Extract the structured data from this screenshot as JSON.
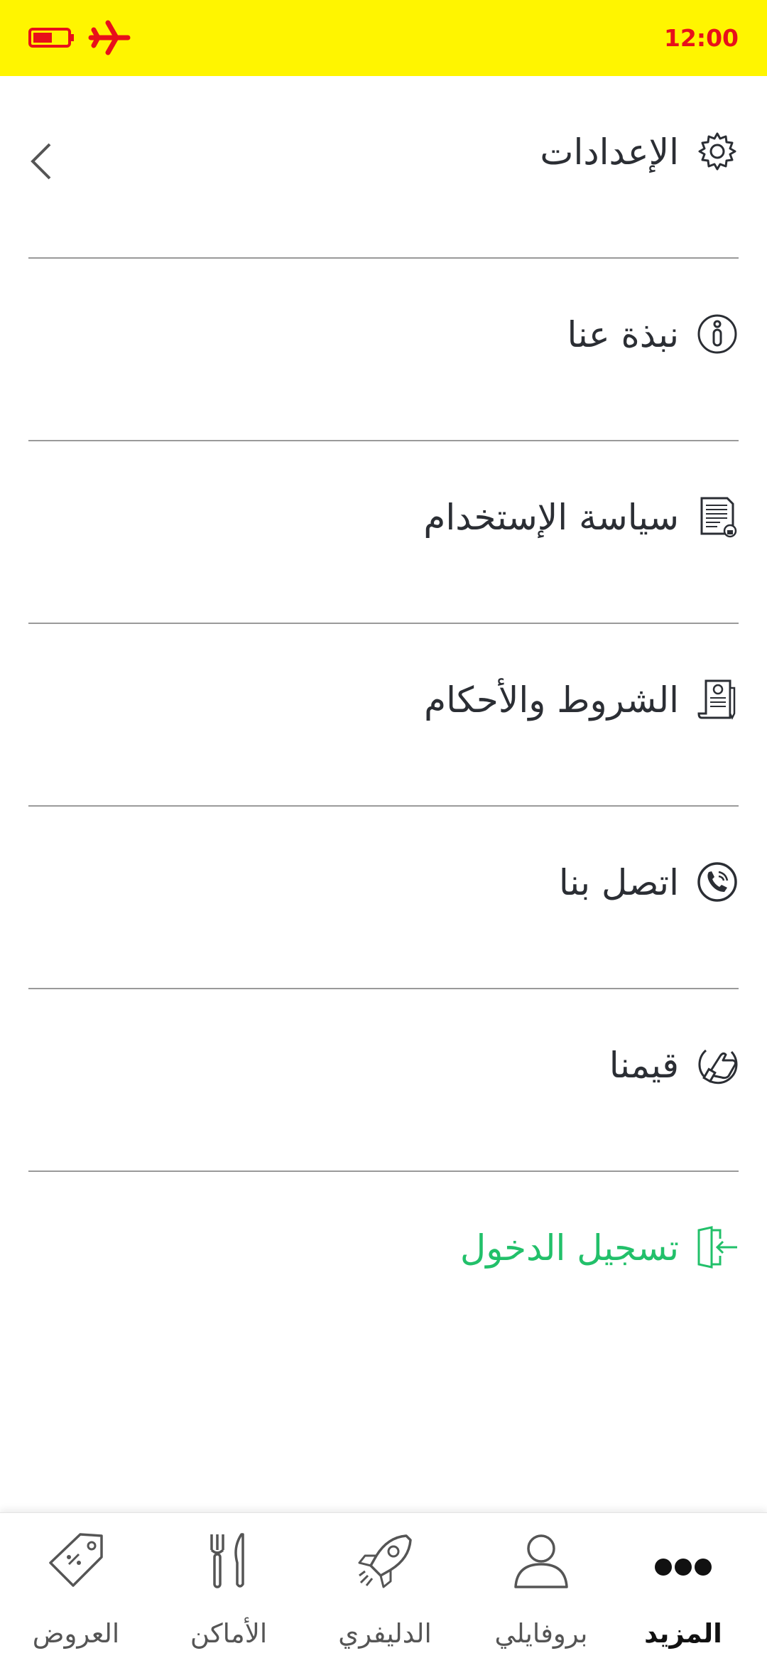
{
  "status_bar": {
    "time": "12:00",
    "accent_color": "#e8101a",
    "background_color": "#fff500",
    "icons": [
      "battery-icon",
      "airplane-mode-icon"
    ]
  },
  "menu": {
    "items": [
      {
        "label": "الإعدادات",
        "icon": "gear-icon"
      },
      {
        "label": "نبذة عنا",
        "icon": "info-icon"
      },
      {
        "label": "سياسة الإستخدام",
        "icon": "document-lock-icon"
      },
      {
        "label": "الشروط والأحكام",
        "icon": "contract-pen-icon"
      },
      {
        "label": "اتصل بنا",
        "icon": "phone-icon"
      },
      {
        "label": "قيمنا",
        "icon": "thumbs-up-icon"
      },
      {
        "label": "تسجيل الدخول",
        "icon": "login-icon",
        "color": "#22c06a"
      }
    ],
    "back_icon": "chevron-left-icon"
  },
  "tab_bar": {
    "tabs": [
      {
        "label": "المزيد",
        "icon": "more-dots-icon",
        "active": true
      },
      {
        "label": "بروفايلي",
        "icon": "user-icon",
        "active": false
      },
      {
        "label": "الدليفري",
        "icon": "rocket-icon",
        "active": false
      },
      {
        "label": "الأماكن",
        "icon": "fork-knife-icon",
        "active": false
      },
      {
        "label": "العروض",
        "icon": "price-tag-icon",
        "active": false
      }
    ]
  }
}
